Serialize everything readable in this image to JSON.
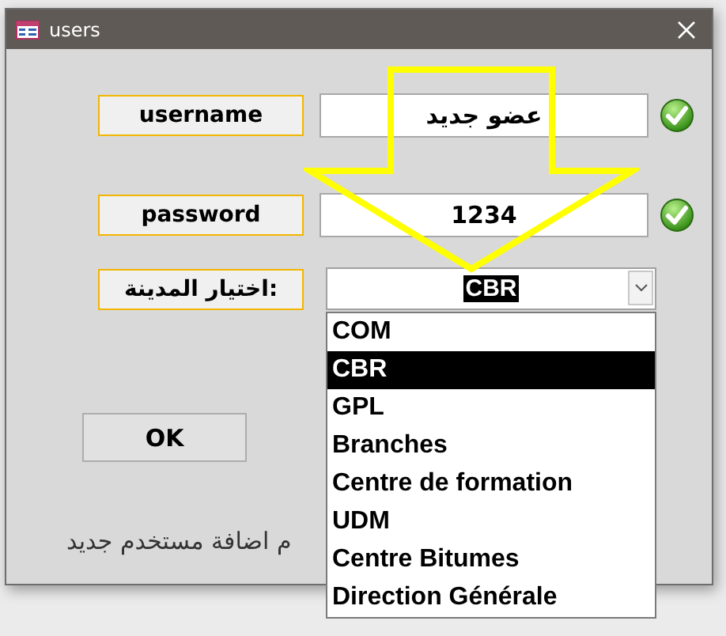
{
  "window": {
    "title": "users"
  },
  "fields": [
    {
      "label": "username",
      "value": "عضو جديد",
      "valid": true
    },
    {
      "label": "password",
      "value": "1234",
      "valid": true
    }
  ],
  "city": {
    "label": "اختيار المدينة:",
    "value": "CBR",
    "expanded": true,
    "options": [
      {
        "label": "COM",
        "selected": false
      },
      {
        "label": "CBR",
        "selected": true
      },
      {
        "label": "GPL",
        "selected": false
      },
      {
        "label": "Branches",
        "selected": false
      },
      {
        "label": "Centre de formation",
        "selected": false
      },
      {
        "label": "UDM",
        "selected": false
      },
      {
        "label": "Centre Bitumes",
        "selected": false
      },
      {
        "label": "Direction Générale",
        "selected": false
      }
    ]
  },
  "buttons": [
    "OK"
  ],
  "status": "م اضافة  مستخدم جديد"
}
